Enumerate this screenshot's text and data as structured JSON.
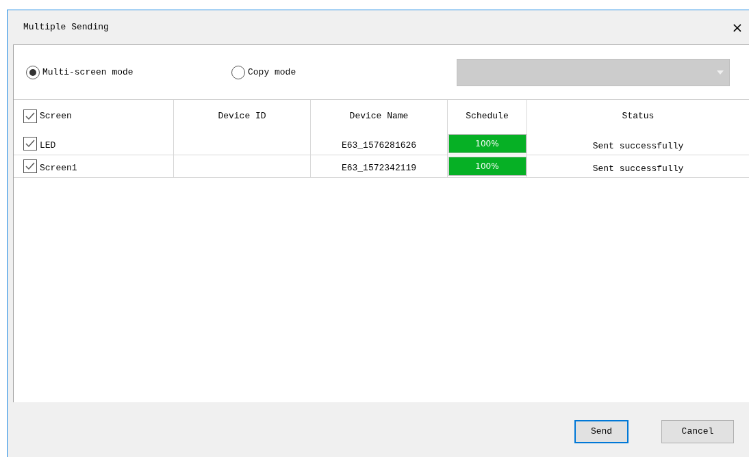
{
  "window": {
    "title": "Multiple Sending",
    "close": "×"
  },
  "modes": [
    {
      "label": "Multi-screen mode",
      "selected": true
    },
    {
      "label": "Copy mode",
      "selected": false
    }
  ],
  "dropdown": {
    "disabled": true
  },
  "table": {
    "columns": [
      "Screen",
      "Device ID",
      "Device Name",
      "Schedule",
      "Status"
    ],
    "all_checked": true,
    "rows": [
      {
        "screen": "LED",
        "checked": true,
        "device_id": "",
        "device_name": "E63_1576281626",
        "schedule": "100%",
        "level": 1,
        "status": "Sent successfully"
      },
      {
        "screen": "Screen1",
        "checked": true,
        "device_id": "",
        "device_name": "E63_1572342119",
        "schedule": "100%",
        "level": 1,
        "status": "Sent successfully"
      }
    ]
  },
  "buttons": [
    {
      "label": "Send",
      "selected": true
    },
    {
      "label": "Cancel",
      "selected": false
    }
  ]
}
